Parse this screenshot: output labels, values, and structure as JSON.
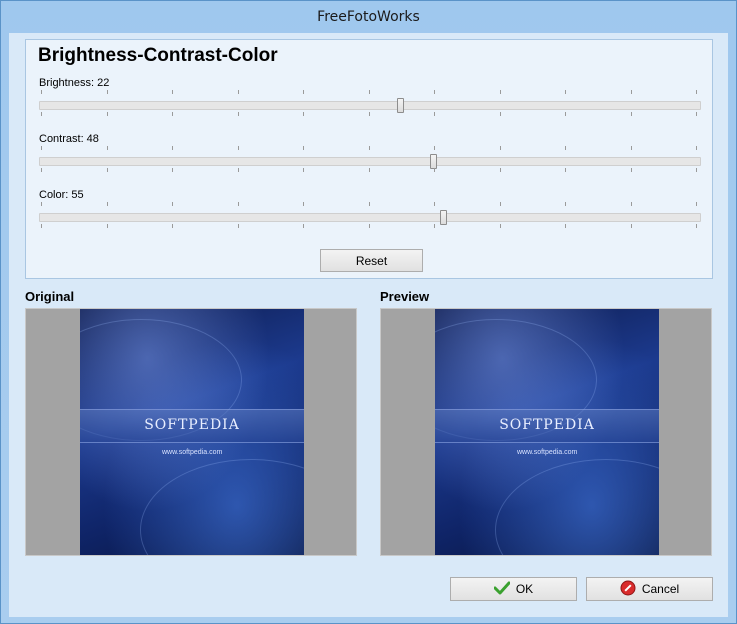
{
  "window": {
    "title": "FreeFotoWorks"
  },
  "panel": {
    "title": "Brightness-Contrast-Color",
    "sliders": [
      {
        "label": "Brightness: 22",
        "value": 22
      },
      {
        "label": "Contrast: 48",
        "value": 48
      },
      {
        "label": "Color: 55",
        "value": 55
      }
    ],
    "reset_label": "Reset"
  },
  "original": {
    "label": "Original",
    "logo_text": "SOFTPEDIA",
    "url_text": "www.softpedia.com"
  },
  "preview": {
    "label": "Preview",
    "logo_text": "SOFTPEDIA",
    "url_text": "www.softpedia.com"
  },
  "buttons": {
    "ok_label": "OK",
    "cancel_label": "Cancel"
  },
  "icons": {
    "ok": "checkmark-icon",
    "cancel": "no-entry-icon"
  },
  "colors": {
    "ok_icon": "#3aa12f",
    "cancel_icon": "#d92b2b"
  }
}
